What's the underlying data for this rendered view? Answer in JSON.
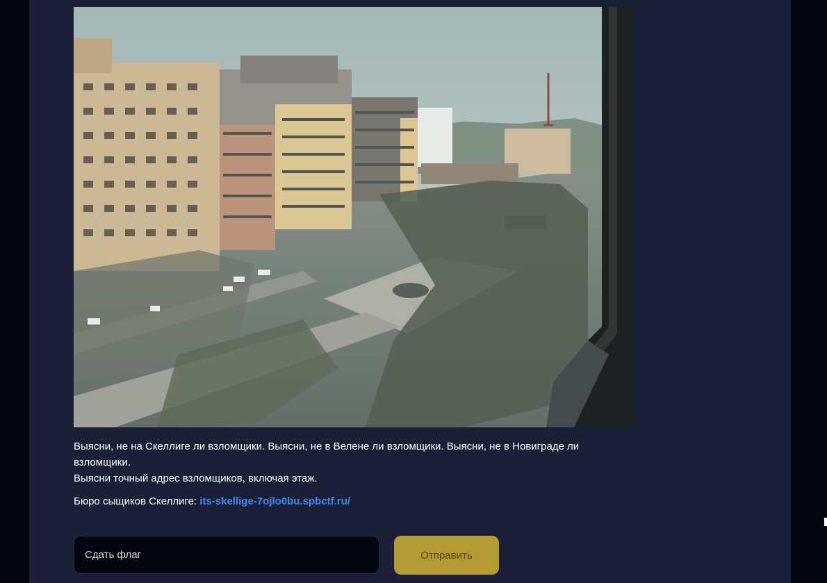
{
  "task": {
    "line1": "Выясни, не на Скеллиге ли взломщики. Выясни, не в Велене ли взломщики. Выясни, не в Новиграде ли взломщики.",
    "line2": "Выясни точный адрес взломщиков, включая этаж.",
    "bureau_label": "Бюро сыщиков Скеллиге:",
    "bureau_link": "its-skellige-7ojlo0bu.spbctf.ru/"
  },
  "form": {
    "flag_placeholder": "Сдать флаг",
    "flag_value": "",
    "submit_label": "Отправить"
  },
  "colors": {
    "page_background": "#03050f",
    "panel_background": "#1c1f38",
    "link": "#3d8bf2",
    "submit_button": "#b49a32"
  }
}
